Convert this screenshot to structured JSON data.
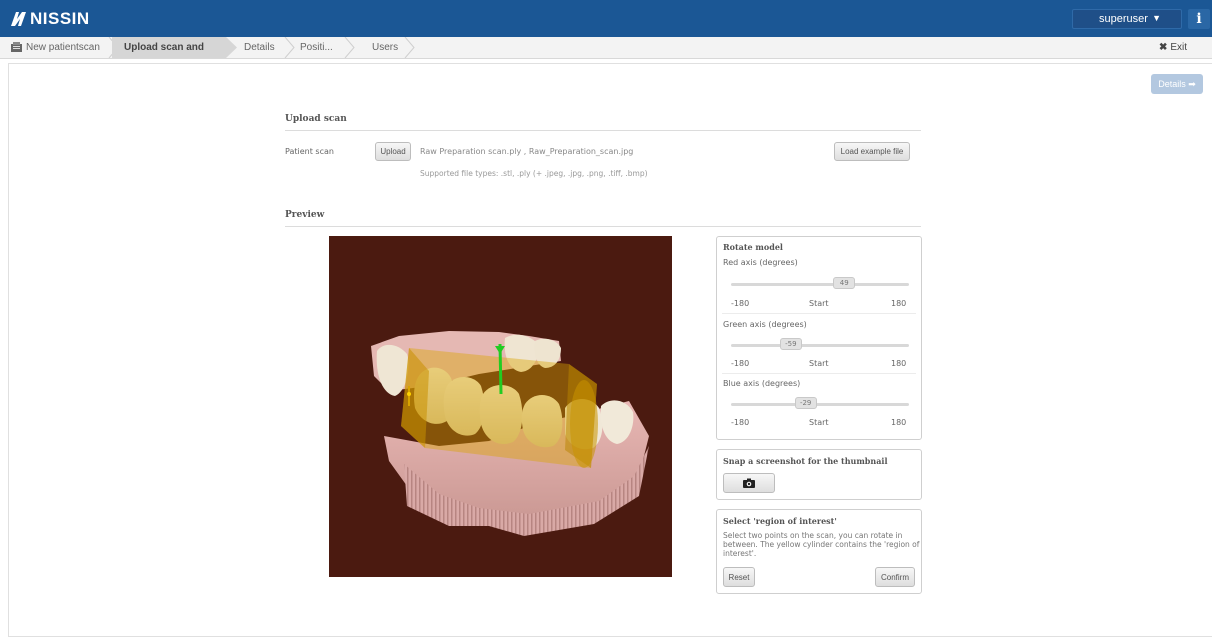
{
  "header": {
    "brand": "NISSIN",
    "user": "superuser",
    "info_label": "i"
  },
  "breadcrumb": {
    "items": [
      {
        "label": "New patientscan",
        "active": false
      },
      {
        "label": "Upload scan and crop",
        "active": true
      },
      {
        "label": "Details",
        "active": false
      },
      {
        "label": "Positi...",
        "active": false
      },
      {
        "label": "Users",
        "active": false
      }
    ],
    "exit_label": "Exit wizard"
  },
  "toolbar": {
    "details_label": "Details ➡"
  },
  "upload": {
    "section_title": "Upload scan",
    "patient_scan_label": "Patient scan",
    "upload_button": "Upload",
    "filename": "Raw Preparation scan.ply , Raw_Preparation_scan.jpg",
    "supported_types": "Supported file types: .stl, .ply (+ .jpeg, .jpg, .png, .tiff, .bmp)",
    "load_example_button": "Load example file"
  },
  "preview": {
    "section_title": "Preview"
  },
  "rotate": {
    "title": "Rotate model",
    "axes": [
      {
        "label": "Red axis (degrees)",
        "value": "49",
        "min": "-180",
        "max": "180",
        "center": "Start",
        "level": 49
      },
      {
        "label": "Green axis (degrees)",
        "value": "-59",
        "min": "-180",
        "max": "180",
        "center": "Start",
        "level": -59
      },
      {
        "label": "Blue axis (degrees)",
        "value": "-29",
        "min": "-180",
        "max": "180",
        "center": "Start",
        "level": -29
      }
    ]
  },
  "snapshot": {
    "title": "Snap a screenshot for the thumbnail",
    "button_icon": "camera-icon"
  },
  "roi": {
    "title": "Select 'region of interest'",
    "description": "Select two points on the scan, you can rotate in between. The yellow cylinder contains the 'region of interest'.",
    "reset_button": "Reset",
    "confirm_button": "Confirm"
  },
  "colors": {
    "header_bg": "#1b5795",
    "viewer_bg": "#4b1a10",
    "roi_cylinder": "#d9a400",
    "axis_green": "#22cc22"
  }
}
